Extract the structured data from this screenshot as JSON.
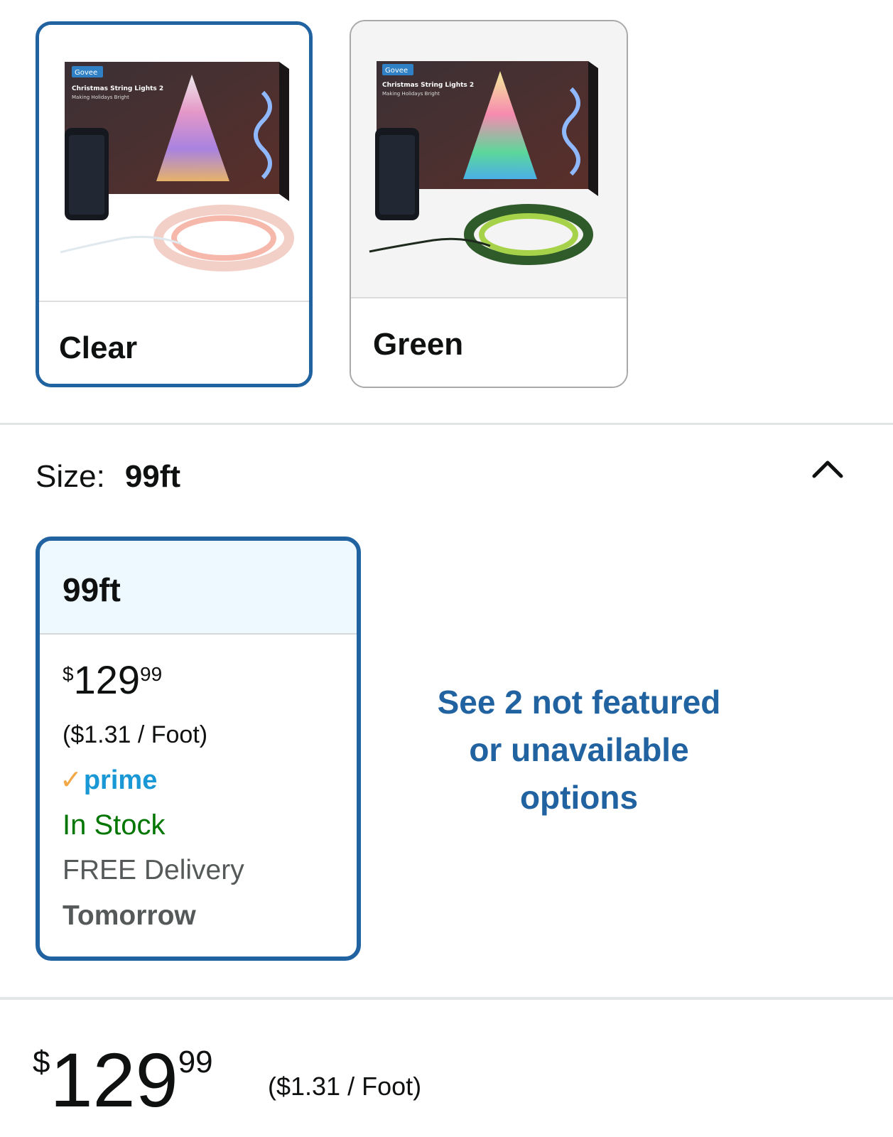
{
  "colors": {
    "selected_border": "#2162a1",
    "link_blue": "#2162a1",
    "in_stock_green": "#007600",
    "prime_blue": "#1a98d5",
    "prime_check": "#f3a847",
    "selected_header_bg": "#edf8ff"
  },
  "color_options": [
    {
      "label": "Clear",
      "selected": true,
      "image": {
        "brand": "Govee",
        "title": "Christmas String Lights 2",
        "subtitle": "Making Holidays Bright"
      }
    },
    {
      "label": "Green",
      "selected": false,
      "image": {
        "brand": "Govee",
        "title": "Christmas String Lights 2",
        "subtitle": "Making Holidays Bright"
      }
    }
  ],
  "size": {
    "label": "Size:",
    "value": "99ft",
    "collapse_icon": "chevron-up-icon"
  },
  "size_option": {
    "name": "99ft",
    "price": {
      "symbol": "$",
      "whole": "129",
      "fraction": "99"
    },
    "unit_price": "($1.31 / Foot)",
    "prime_check": "✓",
    "prime_label": "prime",
    "stock": "In Stock",
    "delivery": "FREE Delivery",
    "delivery_day": "Tomorrow"
  },
  "see_more": {
    "line1": "See 2 not featured",
    "line2": "or unavailable",
    "line3": "options"
  },
  "buy_box": {
    "price": {
      "symbol": "$",
      "whole": "129",
      "fraction": "99"
    },
    "unit_price": "($1.31 / Foot)"
  }
}
